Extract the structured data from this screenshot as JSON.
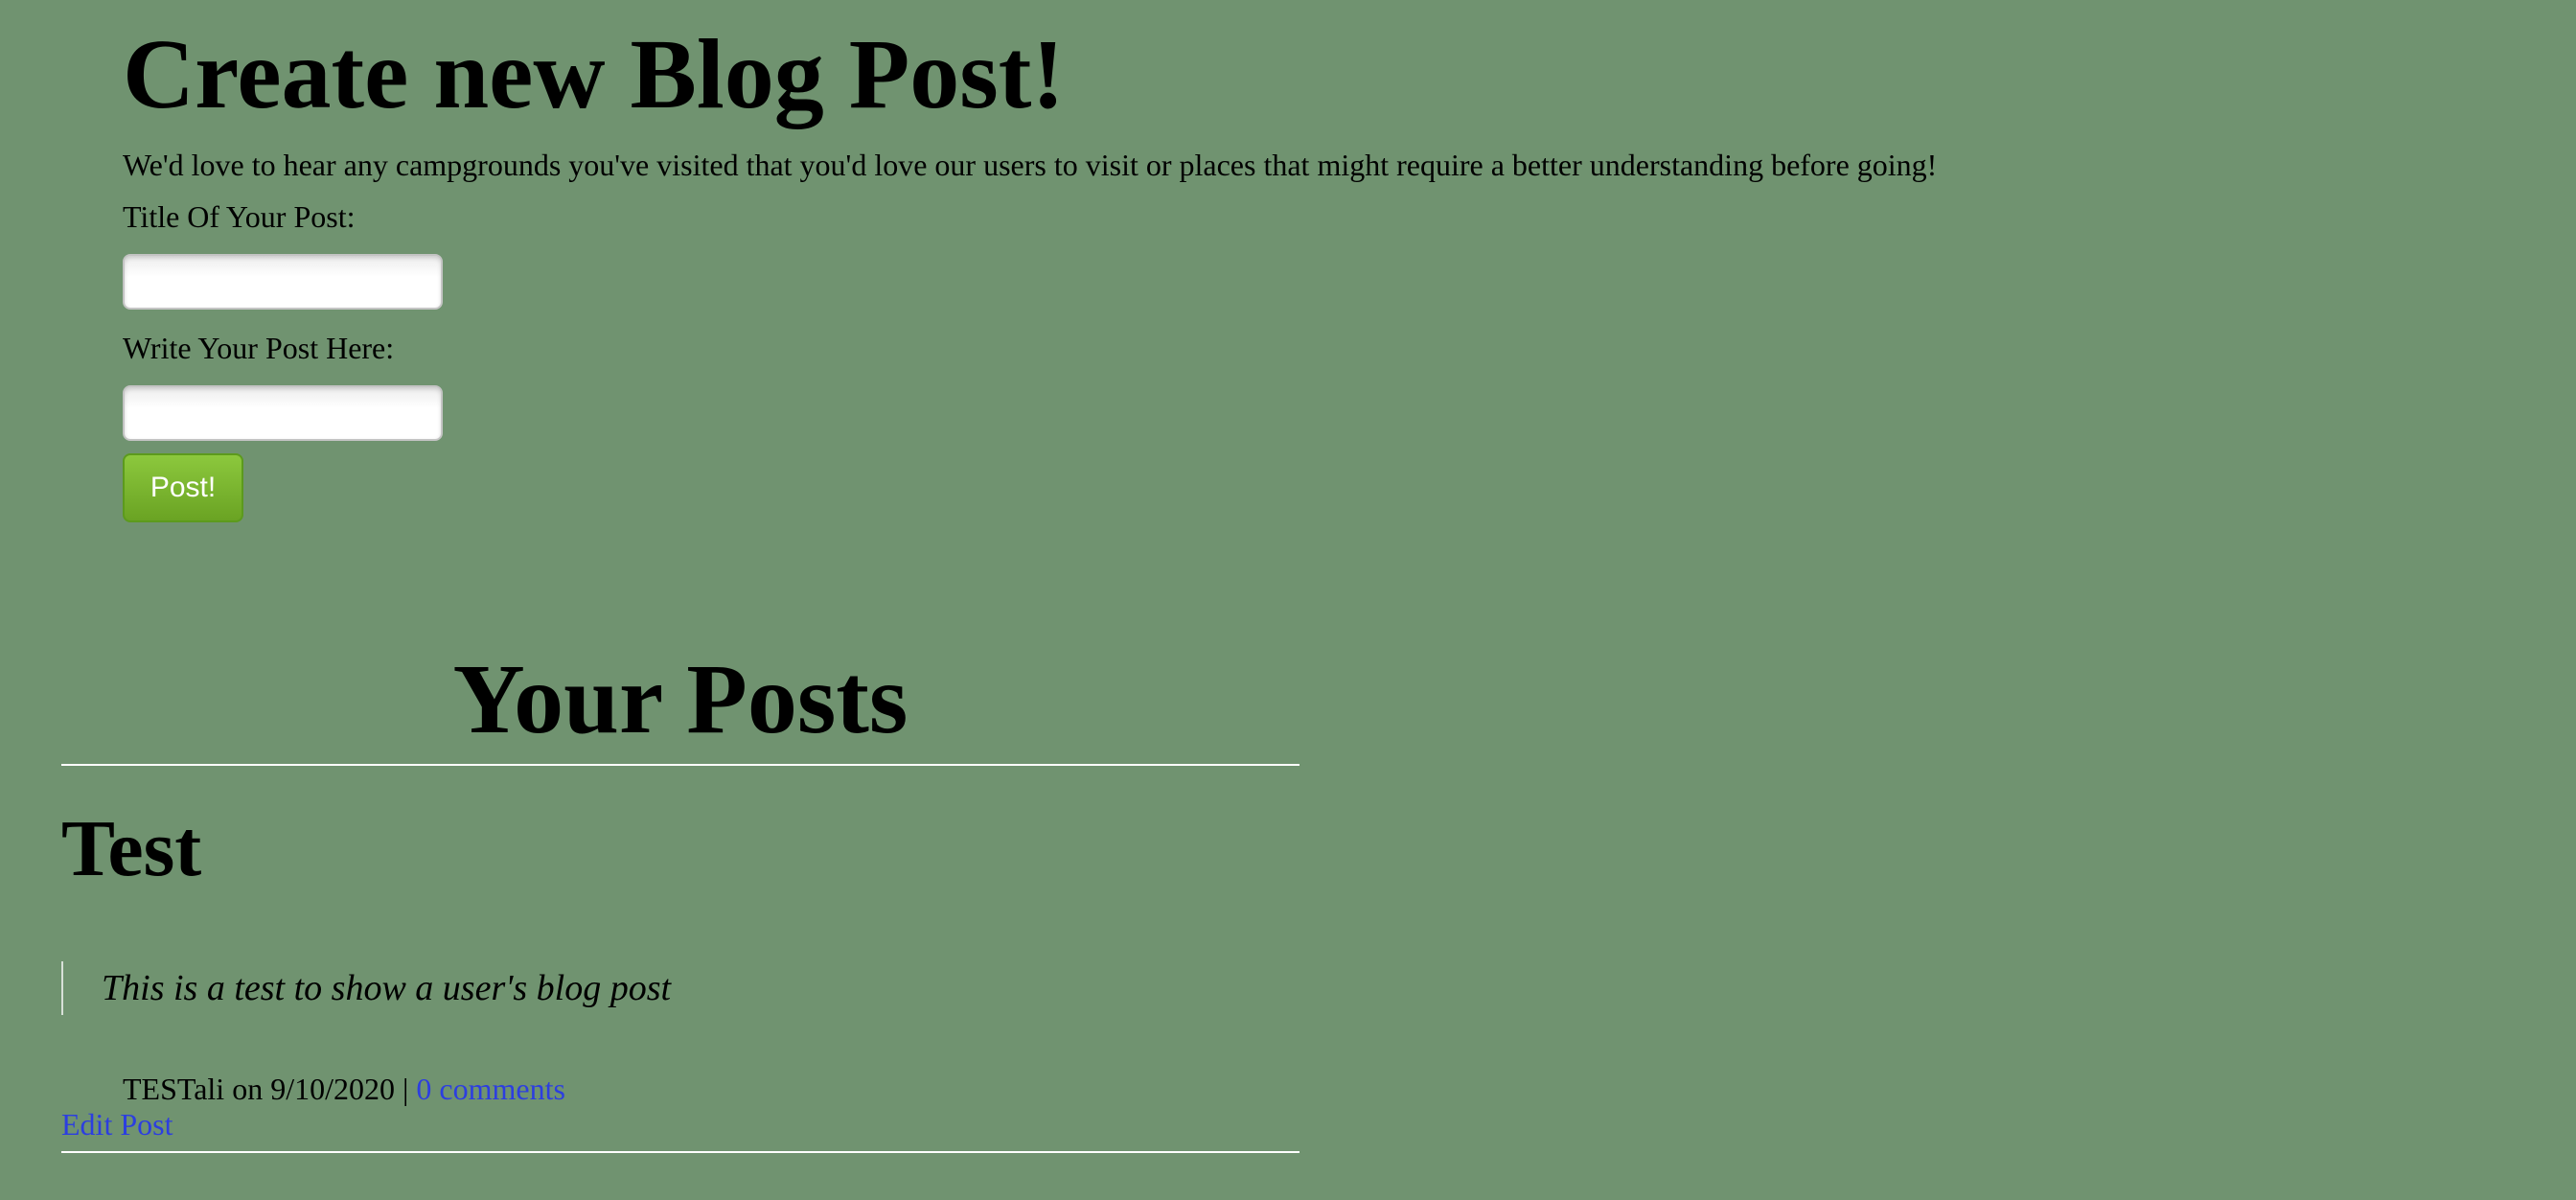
{
  "create": {
    "heading": "Create new Blog Post!",
    "intro": "We'd love to hear any campgrounds you've visited that you'd love our users to visit or places that might require a better understanding before going!",
    "title_label": "Title Of Your Post:",
    "title_value": "",
    "body_label": "Write Your Post Here:",
    "body_value": "",
    "submit_label": "Post!"
  },
  "posts": {
    "heading": "Your Posts",
    "items": [
      {
        "title": "Test",
        "body": "This is a test to show a user's blog post",
        "author_date": "TESTali on 9/10/2020 | ",
        "comments_label": "0 comments",
        "edit_label": "Edit Post"
      }
    ]
  },
  "colors": {
    "background": "#709370",
    "button": "#7ab52f",
    "link": "#2c3ee0"
  }
}
